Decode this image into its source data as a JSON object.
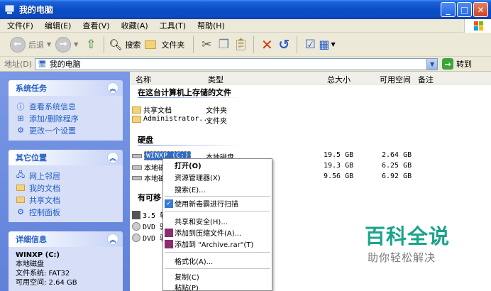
{
  "window": {
    "title": "我的电脑"
  },
  "menu": [
    "文件(F)",
    "编辑(E)",
    "查看(V)",
    "收藏(A)",
    "工具(T)",
    "帮助(H)"
  ],
  "toolbar": {
    "back_label": "后退",
    "search_label": "搜索",
    "folders_label": "文件夹"
  },
  "address": {
    "label": "地址(D)",
    "value": "我的电脑",
    "go_label": "转到"
  },
  "left_panels": {
    "system_tasks": {
      "title": "系统任务",
      "items": [
        "查看系统信息",
        "添加/删除程序",
        "更改一个设置"
      ]
    },
    "other_places": {
      "title": "其它位置",
      "items": [
        "网上邻居",
        "我的文档",
        "共享文档",
        "控制面板"
      ]
    },
    "details": {
      "title": "详细信息",
      "name": "WINXP (C:)",
      "type": "本地磁盘",
      "fs": "文件系统: FAT32",
      "free": "可用空间: 2.64 GB"
    }
  },
  "columns": {
    "name": "名称",
    "type": "类型",
    "total": "总大小",
    "free": "可用空间",
    "notes": "备注"
  },
  "groups": {
    "stored": {
      "title": "在这台计算机上存储的文件",
      "rows": [
        {
          "name": "共享文档",
          "type": "文件夹"
        },
        {
          "name": "Administrator...",
          "type": "文件夹"
        }
      ]
    },
    "hdd": {
      "title": "硬盘",
      "rows": [
        {
          "name": "WINXP (C:)",
          "type": "本地磁盘",
          "total": "19.5 GB",
          "free": "2.64 GB"
        },
        {
          "name": "本地磁",
          "type": "",
          "total": "19.3 GB",
          "free": "6.25 GB"
        },
        {
          "name": "本地磁",
          "type": "",
          "total": "9.56 GB",
          "free": "6.92 GB"
        }
      ]
    },
    "removable": {
      "title": "有可移",
      "rows": [
        {
          "name": "3.5 软"
        },
        {
          "name": "DVD 驱"
        },
        {
          "name": "DVD 驱"
        }
      ]
    }
  },
  "context_menu": {
    "open": "打开(O)",
    "explorer": "资源管理器(X)",
    "search": "搜索(E)...",
    "scan": "使用新毒霸进行扫描",
    "share": "共享和安全(H)...",
    "add_archive": "添加到压缩文件(A)...",
    "add_rar": "添加到 \"Archive.rar\"(T)",
    "format": "格式化(A)...",
    "copy": "复制(C)",
    "paste": "粘贴(P)"
  },
  "watermark": {
    "main": "百科全说",
    "sub": "助你轻松解决"
  }
}
